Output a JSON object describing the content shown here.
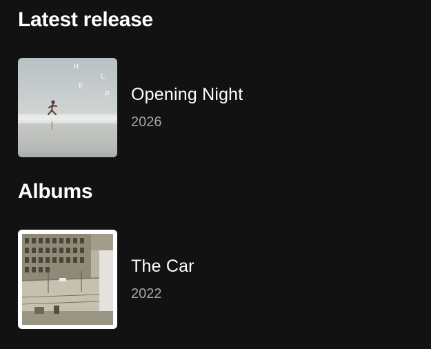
{
  "latest_release": {
    "heading": "Latest release",
    "item": {
      "name": "Opening Night",
      "year": "2026",
      "cover_letters": [
        "H",
        "E",
        "L",
        "P"
      ]
    }
  },
  "albums": {
    "heading": "Albums",
    "items": [
      {
        "name": "The Car",
        "year": "2022"
      }
    ]
  }
}
